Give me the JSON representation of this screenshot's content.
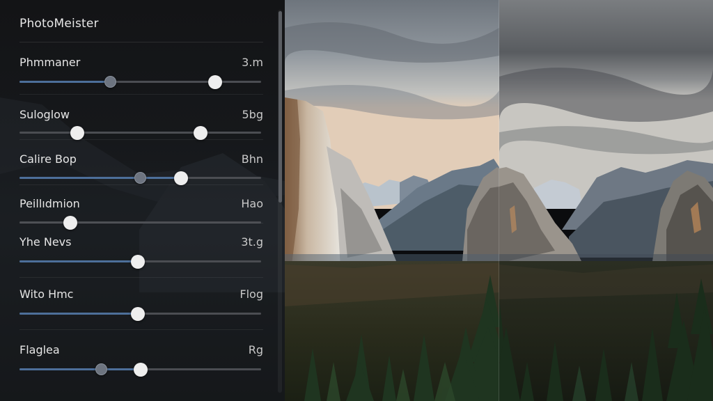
{
  "app": {
    "title": "PhotoMeister"
  },
  "colors": {
    "panel_bg": "#16181b",
    "accent": "#4d6f9a",
    "track": "#4b4d52",
    "thumb": "#eeeeee"
  },
  "sliders": [
    {
      "label": "Phmmaner",
      "value_text": "3.m",
      "fill": 0.375,
      "thumbs": [
        0.375,
        0.81
      ],
      "dark_thumb": 0
    },
    {
      "label": "Suloglow",
      "value_text": "5bg",
      "fill": 0,
      "thumbs": [
        0.24,
        0.75
      ],
      "dark_thumb": -1
    },
    {
      "label": "Calire Bop",
      "value_text": "Bhn",
      "fill": 0.67,
      "thumbs": [
        0.5,
        0.67
      ],
      "dark_thumb": 0
    },
    {
      "label": "Peillıdmion",
      "value_text": "Hao",
      "fill": 0,
      "thumbs": [
        0.21
      ],
      "dark_thumb": -1
    },
    {
      "label": "Yhe Nevs",
      "value_text": "3t.g",
      "fill": 0.49,
      "thumbs": [
        0.49
      ],
      "dark_thumb": -1
    },
    {
      "label": "Wito Hmc",
      "value_text": "Flog",
      "fill": 0.49,
      "thumbs": [
        0.49
      ],
      "dark_thumb": -1
    },
    {
      "label": "Flaglea",
      "value_text": "Rg",
      "fill": 0.5,
      "thumbs": [
        0.34,
        0.5
      ],
      "dark_thumb": 0
    }
  ],
  "photo": {
    "description_icon": "landscape-photo",
    "split_view": true
  }
}
